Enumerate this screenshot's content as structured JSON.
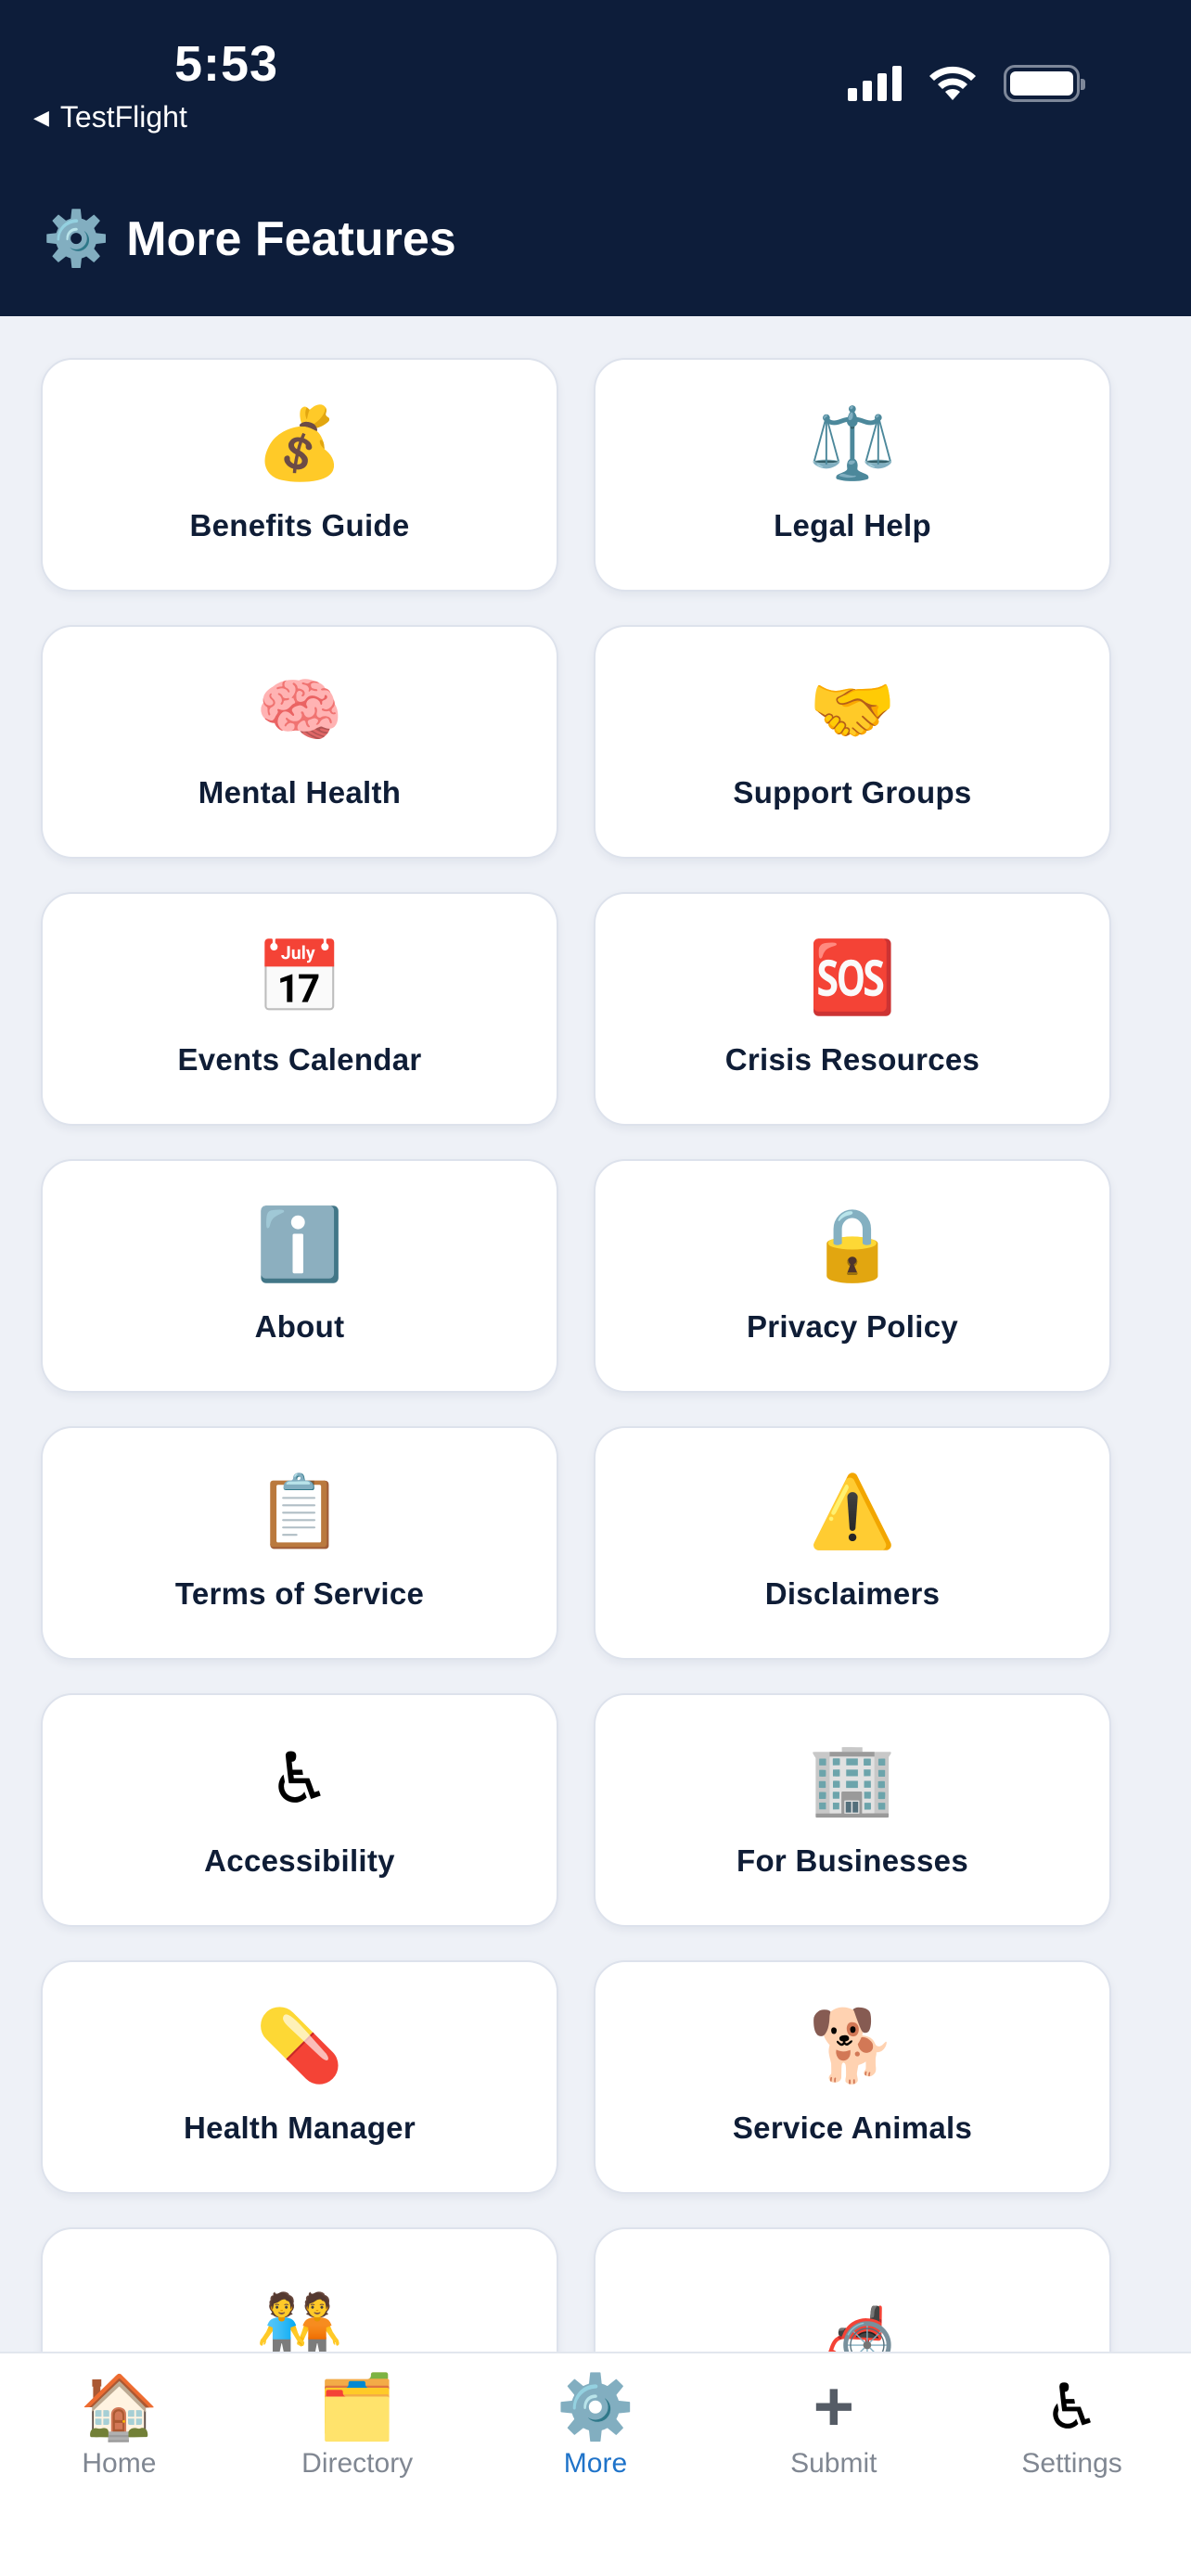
{
  "status_bar": {
    "time": "5:53",
    "back_app": "TestFlight"
  },
  "header": {
    "title_icon": "⚙️",
    "title": "More Features",
    "background_color": "#0d1d3a"
  },
  "cards": [
    {
      "icon": "💰",
      "label": "Benefits Guide"
    },
    {
      "icon": "⚖️",
      "label": "Legal Help"
    },
    {
      "icon": "🧠",
      "label": "Mental Health"
    },
    {
      "icon": "🤝",
      "label": "Support Groups"
    },
    {
      "icon": "📅",
      "label": "Events Calendar"
    },
    {
      "icon": "🆘",
      "label": "Crisis Resources"
    },
    {
      "icon": "ℹ️",
      "label": "About"
    },
    {
      "icon": "🔒",
      "label": "Privacy Policy"
    },
    {
      "icon": "📋",
      "label": "Terms of Service"
    },
    {
      "icon": "⚠️",
      "label": "Disclaimers"
    },
    {
      "icon": "♿",
      "label": "Accessibility"
    },
    {
      "icon": "🏢",
      "label": "For Businesses"
    },
    {
      "icon": "💊",
      "label": "Health Manager"
    },
    {
      "icon": "🐕",
      "label": "Service Animals"
    },
    {
      "icon": "🧑‍🤝‍🧑",
      "label": ""
    },
    {
      "icon": "🦽",
      "label": ""
    }
  ],
  "tabbar": {
    "active_color": "#1f73c9",
    "tabs": [
      {
        "icon": "🏠",
        "label": "Home",
        "active": false
      },
      {
        "icon": "🗂️",
        "label": "Directory",
        "active": false
      },
      {
        "icon": "⚙️",
        "label": "More",
        "active": true
      },
      {
        "icon": "➕",
        "label": "Submit",
        "active": false
      },
      {
        "icon": "♿",
        "label": "Settings",
        "active": false
      }
    ]
  }
}
